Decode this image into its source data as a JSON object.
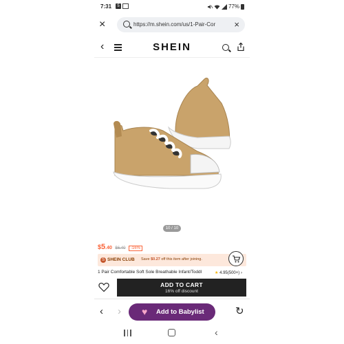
{
  "status_bar": {
    "time": "7:31",
    "notif_badge": "5",
    "battery": "77%"
  },
  "browser": {
    "url": "https://m.shein.com/us/1-Pair-Cor",
    "close_label": "×",
    "clear_label": "×"
  },
  "site": {
    "logo": "SHEIN"
  },
  "gallery": {
    "counter": "10 / 10"
  },
  "product": {
    "currency": "$",
    "price_int": "5",
    "price_dec": ".40",
    "original_price": "$6.40",
    "discount": "-16%",
    "title": "1 Pair Comfortable Soft Sole Breathable Infant/Toddl",
    "rating": "4.95",
    "reviews": "(500+)",
    "rating_arrow": "›"
  },
  "club": {
    "name": "SHEIN CLUB",
    "save_prefix": "Save",
    "save_amount": "$0.27",
    "save_suffix": "off this item after joining.",
    "coin": "S"
  },
  "cart": {
    "title": "ADD TO CART",
    "subtitle": "16% off discount"
  },
  "bottom_bar": {
    "babylist": "Add to Babylist"
  },
  "colors": {
    "accent": "#fa6338",
    "club_bg": "#fde8dc",
    "babylist": "#6a2a78",
    "shoe": "#c9a36b"
  }
}
